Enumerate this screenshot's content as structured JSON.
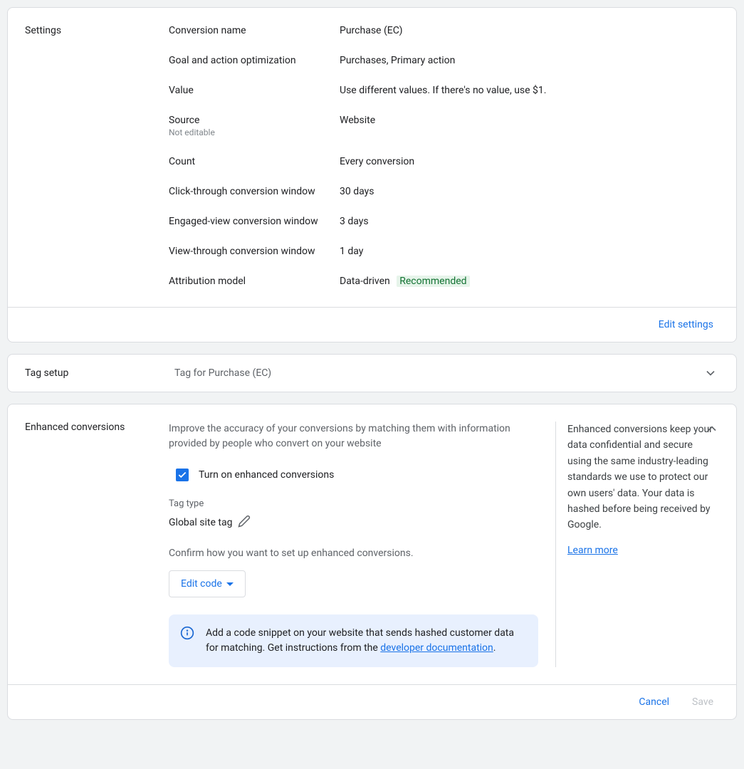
{
  "settings": {
    "heading": "Settings",
    "rows": [
      {
        "label": "Conversion name",
        "value": "Purchase (EC)"
      },
      {
        "label": "Goal and action optimization",
        "value": "Purchases, Primary action"
      },
      {
        "label": "Value",
        "value": "Use different values. If there's no value, use $1."
      },
      {
        "label": "Source",
        "sublabel": "Not editable",
        "value": "Website"
      },
      {
        "label": "Count",
        "value": "Every conversion"
      },
      {
        "label": "Click-through conversion window",
        "value": "30 days"
      },
      {
        "label": "Engaged-view conversion window",
        "value": "3 days"
      },
      {
        "label": "View-through conversion window",
        "value": "1 day"
      },
      {
        "label": "Attribution model",
        "value": "Data-driven",
        "badge": "Recommended"
      }
    ],
    "edit_link": "Edit settings"
  },
  "tag_setup": {
    "heading": "Tag setup",
    "subtitle": "Tag for Purchase (EC)"
  },
  "enhanced": {
    "heading": "Enhanced conversions",
    "description": "Improve the accuracy of your conversions by matching them with information provided by people who convert on your website",
    "checkbox_label": "Turn on enhanced conversions",
    "tag_type_label": "Tag type",
    "tag_type_value": "Global site tag",
    "confirm_text": "Confirm how you want to set up enhanced conversions.",
    "edit_code_label": "Edit code",
    "info_text_1": "Add a code snippet on your website that sends hashed customer data for matching. Get instructions from the ",
    "info_link": "developer documentation",
    "info_text_2": ".",
    "right_text": "Enhanced conversions keep your data confidential and secure using the same industry-leading standards we use to protect our own users' data. Your data is hashed before being received by Google.",
    "learn_more": "Learn more"
  },
  "footer": {
    "cancel": "Cancel",
    "save": "Save"
  }
}
